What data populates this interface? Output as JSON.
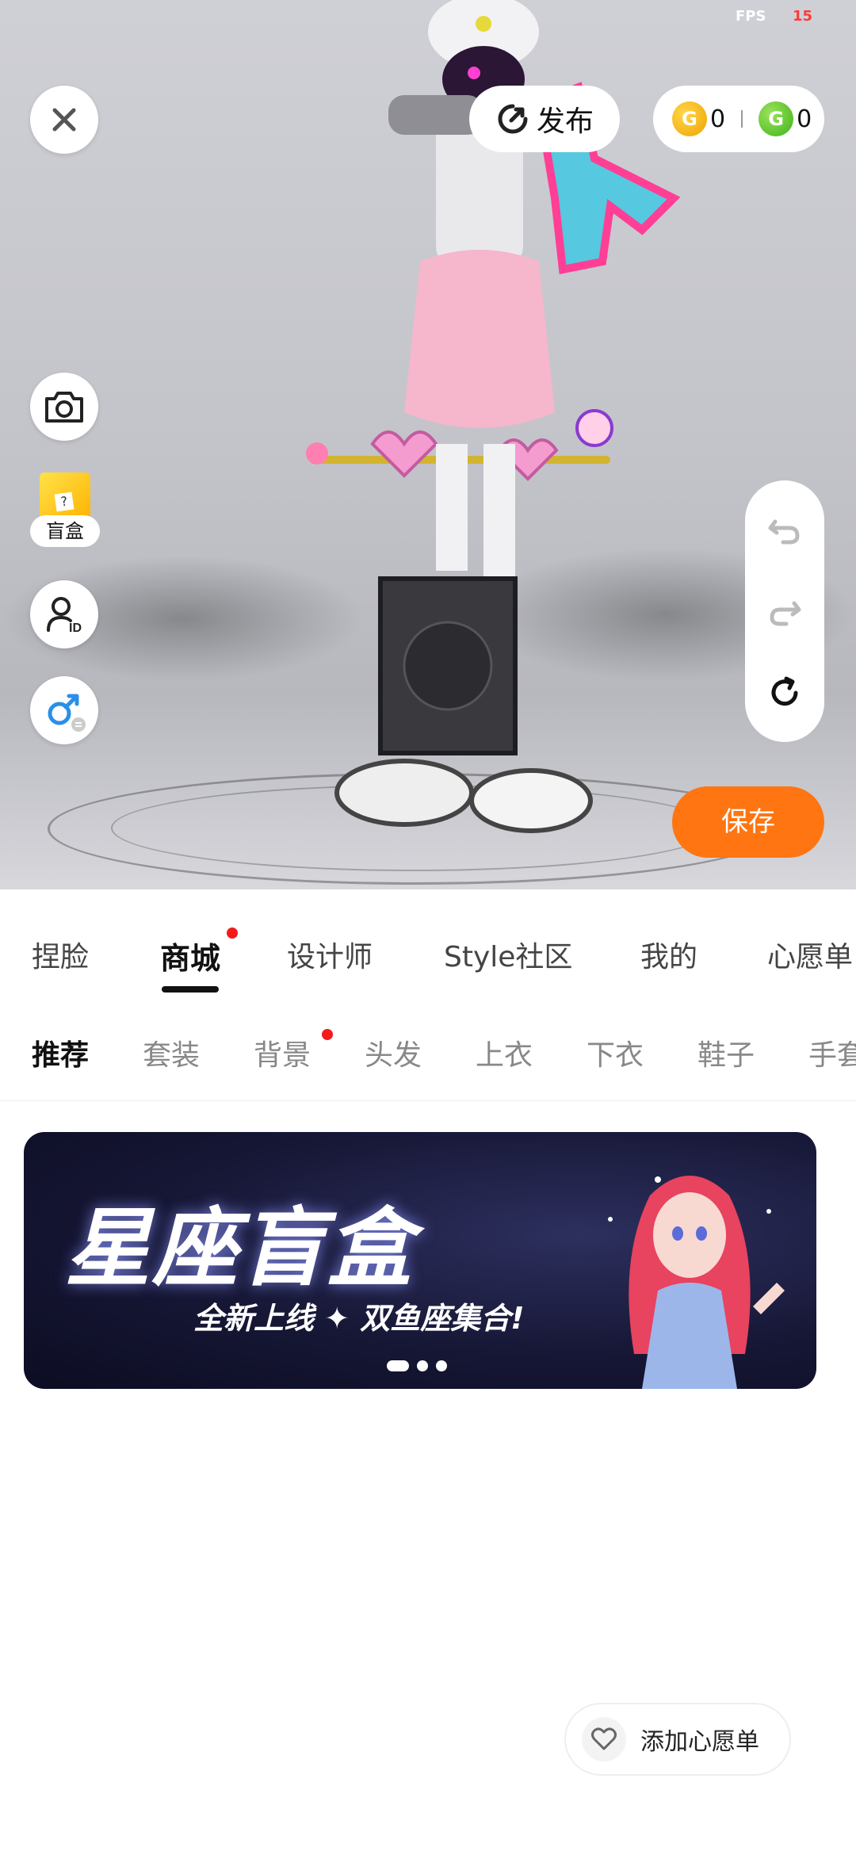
{
  "status": {
    "fps_label": "FPS",
    "fps_value": "15"
  },
  "preview": {
    "publish_label": "发布",
    "coins": {
      "gold_count": "0",
      "green_count": "0"
    },
    "blindbox_label": "盲盒",
    "save_label": "保存"
  },
  "main_tabs": [
    {
      "label": "捏脸"
    },
    {
      "label": "商城"
    },
    {
      "label": "设计师"
    },
    {
      "label": "Style社区"
    },
    {
      "label": "我的"
    },
    {
      "label": "心愿单"
    }
  ],
  "sub_tabs": [
    {
      "label": "推荐"
    },
    {
      "label": "套装"
    },
    {
      "label": "背景"
    },
    {
      "label": "头发"
    },
    {
      "label": "上衣"
    },
    {
      "label": "下衣"
    },
    {
      "label": "鞋子"
    },
    {
      "label": "手套"
    }
  ],
  "banner": {
    "title": "星座盲盒",
    "subtitle": "全新上线 ✦ 双鱼座集合!"
  },
  "wishlist": {
    "label": "添加心愿单"
  },
  "colors": {
    "accent": "#ff7512",
    "badge": "#f21b1b"
  }
}
